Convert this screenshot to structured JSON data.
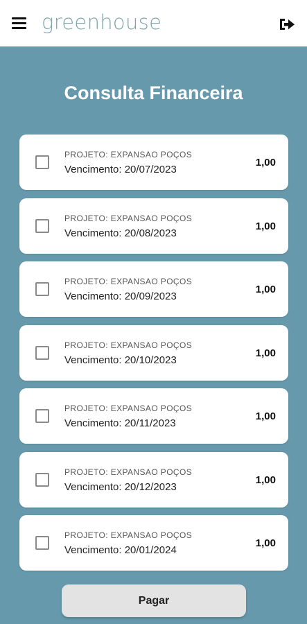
{
  "header": {
    "brand": "greenhouse",
    "menu_icon": "hamburger-menu-icon",
    "logout_icon": "sign-out-icon"
  },
  "page": {
    "title": "Consulta Financeira"
  },
  "items": [
    {
      "project": "PROJETO: EXPANSAO POÇOS",
      "due": "Vencimento: 20/07/2023",
      "amount": "1,00",
      "checked": false
    },
    {
      "project": "PROJETO: EXPANSAO POÇOS",
      "due": "Vencimento: 20/08/2023",
      "amount": "1,00",
      "checked": false
    },
    {
      "project": "PROJETO: EXPANSAO POÇOS",
      "due": "Vencimento: 20/09/2023",
      "amount": "1,00",
      "checked": false
    },
    {
      "project": "PROJETO: EXPANSAO POÇOS",
      "due": "Vencimento: 20/10/2023",
      "amount": "1,00",
      "checked": false
    },
    {
      "project": "PROJETO: EXPANSAO POÇOS",
      "due": "Vencimento: 20/11/2023",
      "amount": "1,00",
      "checked": false
    },
    {
      "project": "PROJETO: EXPANSAO POÇOS",
      "due": "Vencimento: 20/12/2023",
      "amount": "1,00",
      "checked": false
    },
    {
      "project": "PROJETO: EXPANSAO POÇOS",
      "due": "Vencimento: 20/01/2024",
      "amount": "1,00",
      "checked": false
    }
  ],
  "actions": {
    "pay_label": "Pagar"
  },
  "colors": {
    "background": "#6699ab",
    "brand": "#7fa3ad",
    "card": "#ffffff",
    "button": "#e3e3e3"
  }
}
